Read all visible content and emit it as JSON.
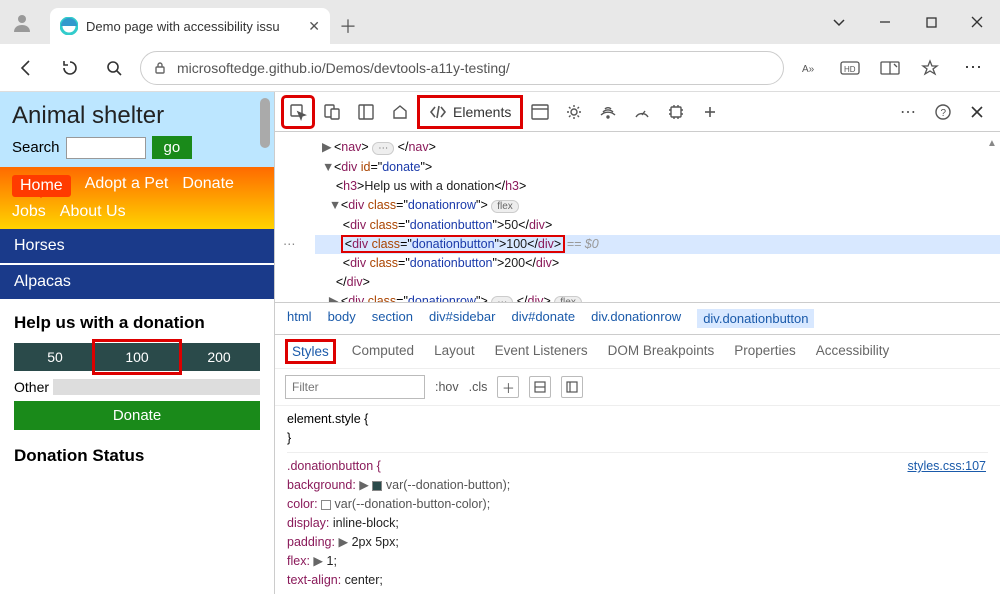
{
  "window": {
    "tab_title": "Demo page with accessibility issu",
    "url_display": "microsoftedge.github.io/Demos/devtools-a11y-testing/"
  },
  "page": {
    "title": "Animal shelter",
    "search_label": "Search",
    "go_label": "go",
    "nav": {
      "home": "Home",
      "adopt": "Adopt a Pet",
      "donate": "Donate",
      "jobs": "Jobs",
      "about": "About Us"
    },
    "cats": [
      "Horses",
      "Alpacas"
    ],
    "donation_heading": "Help us with a donation",
    "donations": [
      "50",
      "100",
      "200"
    ],
    "other_label": "Other",
    "donate_btn": "Donate",
    "status_heading": "Donation Status"
  },
  "devtools": {
    "elements_tab": "Elements",
    "dom": {
      "nav_open": "nav",
      "nav_close": "nav",
      "div_donate_id": "donate",
      "h3_text": "Help us with a donation",
      "class_row": "donationrow",
      "class_btn": "donationbutton",
      "flex_pill": "flex",
      "val50": "50",
      "val100": "100",
      "val200": "200",
      "eq0": "== $0"
    },
    "breadcrumb": [
      "html",
      "body",
      "section",
      "div#sidebar",
      "div#donate",
      "div.donationrow",
      "div.donationbutton"
    ],
    "panel_tabs": [
      "Styles",
      "Computed",
      "Layout",
      "Event Listeners",
      "DOM Breakpoints",
      "Properties",
      "Accessibility"
    ],
    "filter_placeholder": "Filter",
    "hov": ":hov",
    "cls": ".cls",
    "element_style": "element.style {",
    "brace_close": "}",
    "selector": ".donationbutton {",
    "src_link": "styles.css:107",
    "props": {
      "background": "background:",
      "background_val": "var(--donation-button);",
      "color": "color:",
      "color_val": "var(--donation-button-color);",
      "display": "display: inline-block;",
      "padding": "padding:",
      "padding_val": "2px 5px;",
      "flex": "flex:",
      "flex_val": "1;",
      "textalign": "text-align:  center;"
    }
  }
}
